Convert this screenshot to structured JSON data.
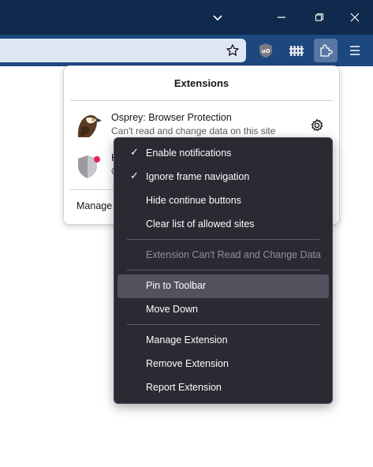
{
  "window": {
    "buttons": [
      "tab-list",
      "minimize",
      "restore",
      "close"
    ]
  },
  "toolbar": {
    "bookmark_icon": "star-icon",
    "buttons": [
      "ublock-origin-icon",
      "fence-extension-icon",
      "extensions-puzzle-icon",
      "hamburger-menu-icon"
    ]
  },
  "extensions_panel": {
    "title": "Extensions",
    "items": [
      {
        "name": "Osprey: Browser Protection",
        "subtitle": "Can't read and change data on this site",
        "icon": "osprey-bird-icon"
      },
      {
        "name": "H",
        "subtitle": "C",
        "icon": "shield-icon"
      }
    ],
    "manage_label": "Manage"
  },
  "context_menu": {
    "items": [
      {
        "label": "Enable notifications",
        "checked": true
      },
      {
        "label": "Ignore frame navigation",
        "checked": true
      },
      {
        "label": "Hide continue buttons",
        "checked": false
      },
      {
        "label": "Clear list of allowed sites",
        "checked": false
      }
    ],
    "status": "Extension Can't Read and Change Data",
    "actions1": [
      "Pin to Toolbar",
      "Move Down"
    ],
    "actions2": [
      "Manage Extension",
      "Remove Extension",
      "Report Extension"
    ]
  },
  "colors": {
    "titlebar": "#0f2a4d",
    "toolbar": "#1d477f",
    "menu_bg": "#2b2a33",
    "menu_hover": "#52525e"
  }
}
